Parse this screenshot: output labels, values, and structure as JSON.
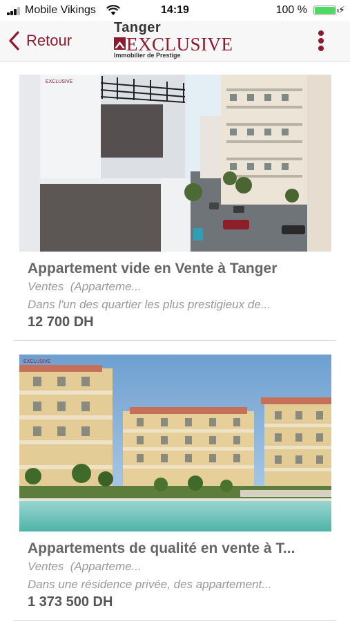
{
  "status_bar": {
    "carrier": "Mobile Vikings",
    "time": "14:19",
    "battery_percent": "100 %",
    "battery_level": 1.0
  },
  "nav": {
    "back_label": "Retour",
    "logo_top": "Tanger",
    "logo_main": "EXCLUSIVE",
    "logo_tagline": "Immobilier de Prestige"
  },
  "listings": [
    {
      "title": "Appartement vide en Vente à Tanger",
      "category": "Ventes  (Apparteme...",
      "description": "Dans l'un des quartier les plus prestigieux de...",
      "price": "12 700 DH"
    },
    {
      "title": "Appartements de qualité en vente à T...",
      "category": "Ventes  (Apparteme...",
      "description": "Dans une résidence privée, des appartement...",
      "price": "1 373 500 DH"
    }
  ]
}
